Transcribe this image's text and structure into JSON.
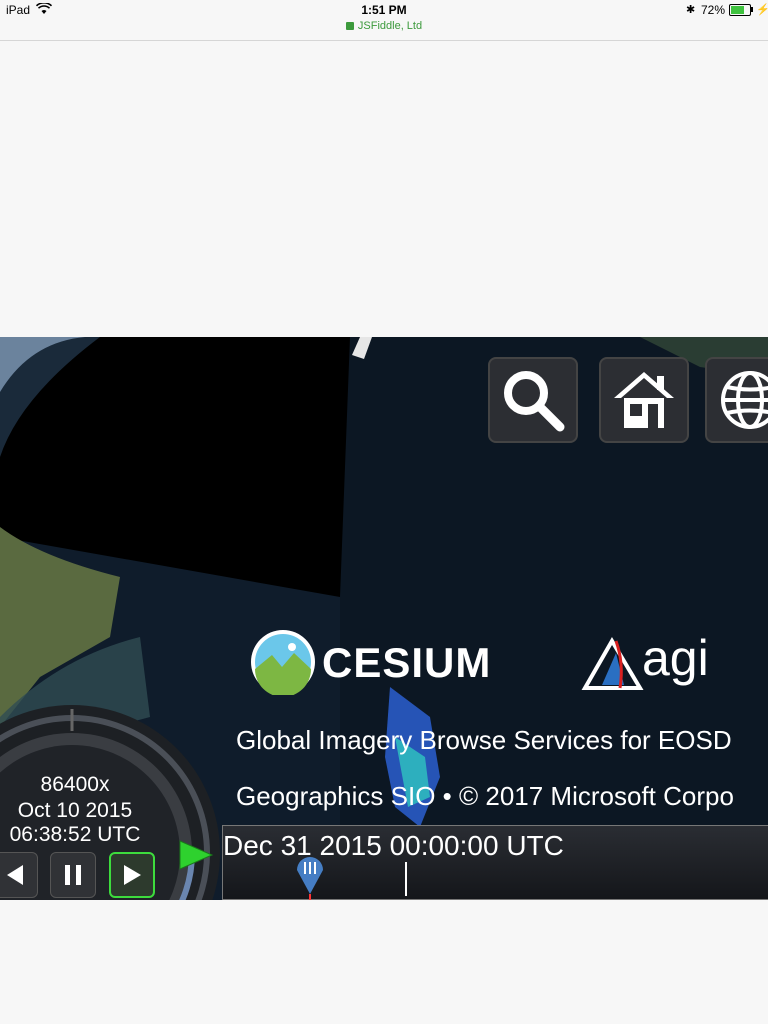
{
  "status_bar": {
    "device": "iPad",
    "time": "1:51 PM",
    "url": "JSFiddle, Ltd",
    "battery_percent": "72%",
    "battery_level": 0.72,
    "icons": [
      "wifi-icon",
      "lock-icon",
      "bluetooth-icon",
      "battery-icon",
      "charging-icon"
    ]
  },
  "toolbar": {
    "buttons": [
      {
        "icon": "search-icon"
      },
      {
        "icon": "home-icon"
      },
      {
        "icon": "globe-icon"
      }
    ]
  },
  "credits": {
    "cesium_text": "CESIUM",
    "agi_text": "agi",
    "line1": "Global Imagery Browse Services for EOSD",
    "line2": "Geographics SIO • © 2017 Microsoft Corpo"
  },
  "animation": {
    "speed": "86400x",
    "date": "Oct 10 2015",
    "time": "06:38:52 UTC"
  },
  "timeline": {
    "label": "Dec 31 2015 00:00:00 UTC"
  },
  "colors": {
    "accent_green": "#3ddc3d",
    "url_green": "#3c9a3c"
  }
}
